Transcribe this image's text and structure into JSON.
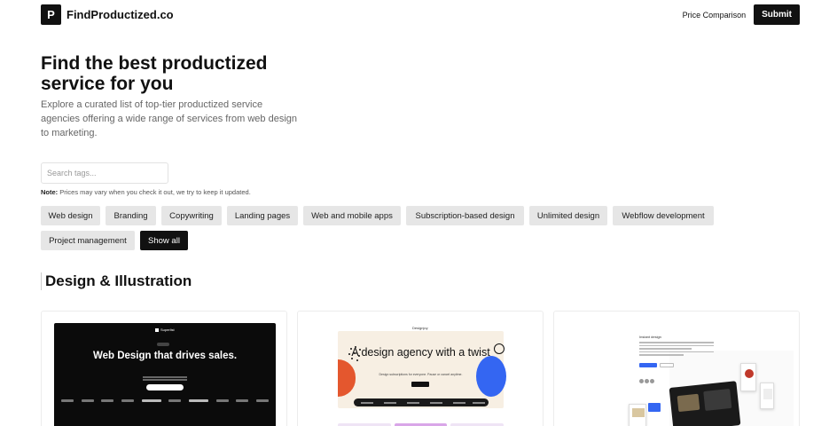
{
  "header": {
    "logo_letter": "P",
    "site_name": "FindProductized.co",
    "nav_link": "Price Comparison",
    "submit_label": "Submit"
  },
  "hero": {
    "title": "Find the best productized service for you",
    "subtitle": "Explore a curated list of top-tier productized service agencies offering a wide range of services from web design to marketing."
  },
  "search": {
    "placeholder": "Search tags..."
  },
  "note": {
    "label": "Note:",
    "text": "Prices may vary when you check it out, we try to keep it updated."
  },
  "tags": [
    "Web design",
    "Branding",
    "Copywriting",
    "Landing pages",
    "Web and mobile apps",
    "Subscription-based design",
    "Unlimited design",
    "Webflow development",
    "Project management"
  ],
  "show_all_label": "Show all",
  "section": {
    "title": "Design & Illustration"
  },
  "cards": [
    {
      "brand": "Superlist",
      "headline": "Web Design that drives sales."
    },
    {
      "brand": "Designjoy",
      "headline": "A design agency with a twist",
      "tagline": "Design subscriptions for everyone. Pause or cancel anytime."
    },
    {
      "heading": "Instant design"
    }
  ],
  "colors": {
    "primary": "#111111",
    "tag_bg": "#e6e6e6",
    "accent_blue": "#3466f2",
    "accent_orange": "#e4572e"
  }
}
